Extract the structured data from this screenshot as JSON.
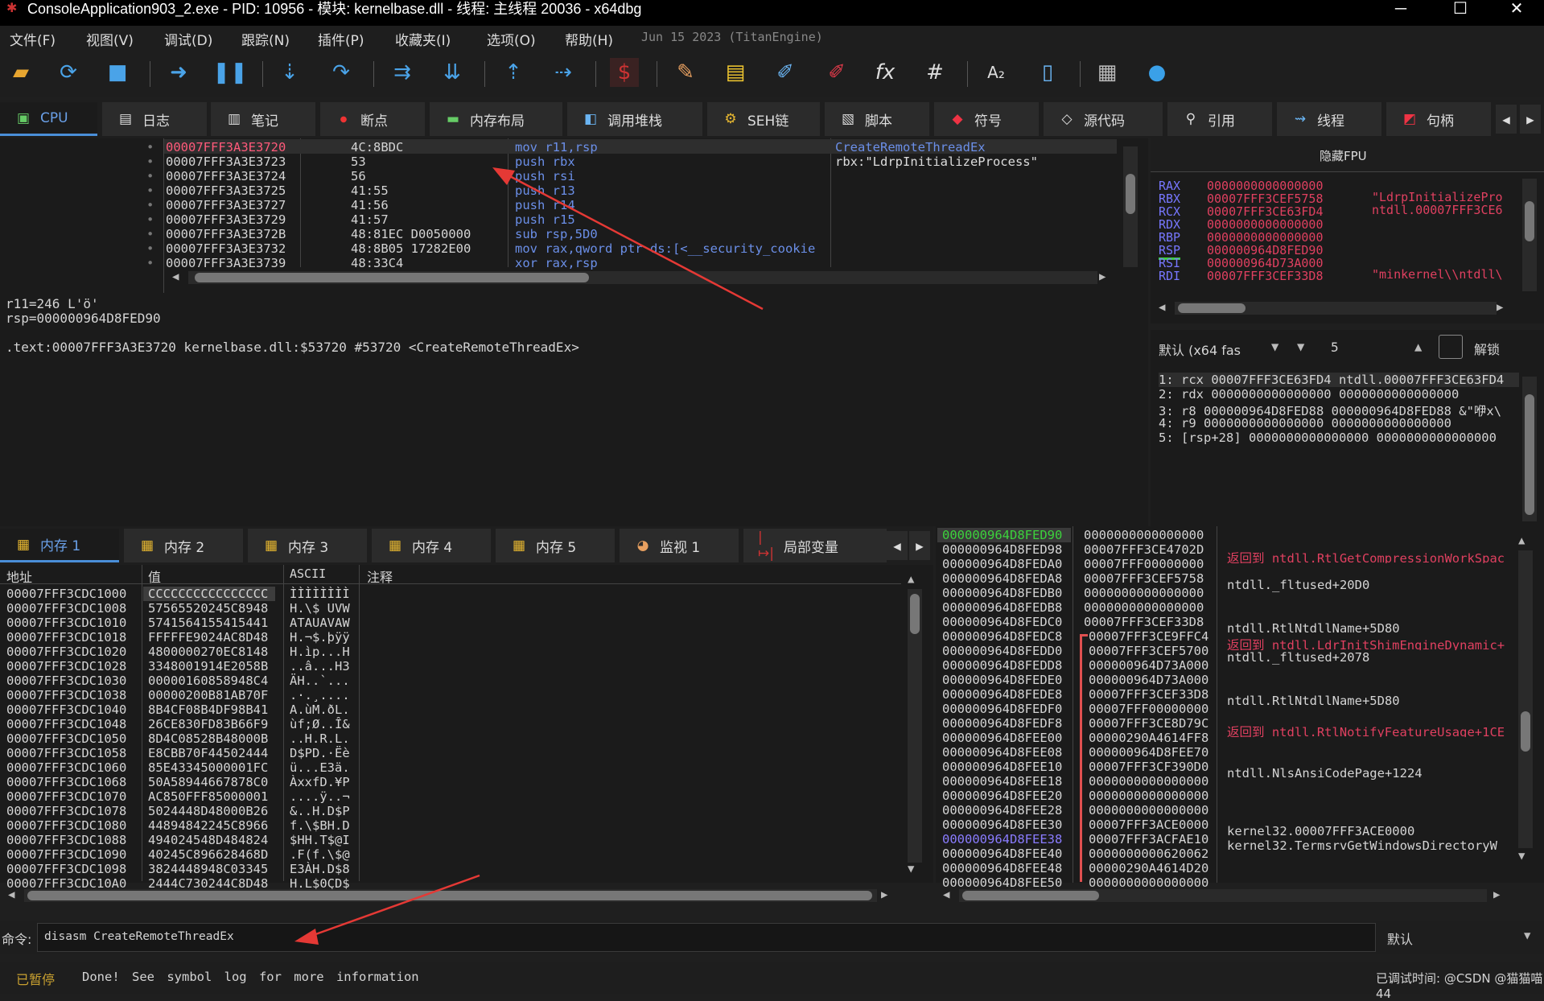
{
  "window": {
    "title": "ConsoleApplication903_2.exe - PID: 10956 - 模块: kernelbase.dll - 线程: 主线程 20036 - x64dbg"
  },
  "menu": {
    "items": [
      "文件(F)",
      "视图(V)",
      "调试(D)",
      "跟踪(N)",
      "插件(P)",
      "收藏夹(I)",
      "选项(O)",
      "帮助(H)"
    ],
    "info": "Jun 15 2023 (TitanEngine)"
  },
  "toolbar": {
    "icons": [
      "open-icon",
      "restart-icon",
      "stop-icon",
      "run-icon",
      "pause-icon",
      "step-into-icon",
      "step-over-icon",
      "trace-into-icon",
      "trace-over-icon",
      "execute-till-return-icon",
      "run-to-user-code-icon",
      "scylla-icon",
      "patch-icon",
      "comment-icon",
      "label-icon",
      "bookmark-icon",
      "function-icon",
      "hash-icon",
      "font-icon",
      "module-icon",
      "calculator-icon",
      "globe-icon"
    ]
  },
  "tabs": [
    {
      "label": "CPU",
      "icon": "cpu-icon"
    },
    {
      "label": "日志",
      "icon": "log-icon"
    },
    {
      "label": "笔记",
      "icon": "notes-icon"
    },
    {
      "label": "断点",
      "icon": "breakpoint-icon"
    },
    {
      "label": "内存布局",
      "icon": "memory-map-icon"
    },
    {
      "label": "调用堆栈",
      "icon": "call-stack-icon"
    },
    {
      "label": "SEH链",
      "icon": "seh-icon"
    },
    {
      "label": "脚本",
      "icon": "script-icon"
    },
    {
      "label": "符号",
      "icon": "symbols-icon"
    },
    {
      "label": "源代码",
      "icon": "source-icon"
    },
    {
      "label": "引用",
      "icon": "references-icon"
    },
    {
      "label": "线程",
      "icon": "threads-icon"
    },
    {
      "label": "句柄",
      "icon": "handles-icon"
    }
  ],
  "disasm": {
    "rows": [
      {
        "addr": "00007FFF3A3E3720",
        "bytes": "4C:8BDC",
        "ins": "mov r11,rsp",
        "cmt": "CreateRemoteThreadEx"
      },
      {
        "addr": "00007FFF3A3E3723",
        "bytes": "53",
        "ins": "push rbx",
        "cmt": "rbx:\"LdrpInitializeProcess\""
      },
      {
        "addr": "00007FFF3A3E3724",
        "bytes": "56",
        "ins": "push rsi",
        "cmt": ""
      },
      {
        "addr": "00007FFF3A3E3725",
        "bytes": "41:55",
        "ins": "push r13",
        "cmt": ""
      },
      {
        "addr": "00007FFF3A3E3727",
        "bytes": "41:56",
        "ins": "push r14",
        "cmt": ""
      },
      {
        "addr": "00007FFF3A3E3729",
        "bytes": "41:57",
        "ins": "push r15",
        "cmt": ""
      },
      {
        "addr": "00007FFF3A3E372B",
        "bytes": "48:81EC D0050000",
        "ins": "sub rsp,5D0",
        "cmt": ""
      },
      {
        "addr": "00007FFF3A3E3732",
        "bytes": "48:8B05 17282E00",
        "ins": "mov rax,qword ptr ds:[<__security_cookie",
        "cmt": ""
      },
      {
        "addr": "00007FFF3A3E3739",
        "bytes": "48:33C4",
        "ins": "xor rax,rsp",
        "cmt": ""
      }
    ]
  },
  "info": {
    "line1": "r11=246 L'ö'",
    "line2": "rsp=000000964D8FED90",
    "line3": ".text:00007FFF3A3E3720 kernelbase.dll:$53720 #53720 <CreateRemoteThreadEx>"
  },
  "regs": {
    "title": "隐藏FPU",
    "rows": [
      {
        "name": "RAX",
        "val": "0000000000000000",
        "cmt": ""
      },
      {
        "name": "RBX",
        "val": "00007FFF3CEF5758",
        "cmt": "\"LdrpInitializePro"
      },
      {
        "name": "RCX",
        "val": "00007FFF3CE63FD4",
        "cmt": "ntdll.00007FFF3CE6"
      },
      {
        "name": "RDX",
        "val": "0000000000000000",
        "cmt": ""
      },
      {
        "name": "RBP",
        "val": "0000000000000000",
        "cmt": ""
      },
      {
        "name": "RSP",
        "val": "000000964D8FED90",
        "cmt": ""
      },
      {
        "name": "RSI",
        "val": "000000964D73A000",
        "cmt": ""
      },
      {
        "name": "RDI",
        "val": "00007FFF3CEF33D8",
        "cmt": "\"minkernel\\\\ntdll\\"
      }
    ]
  },
  "callconv": {
    "select": "默认 (x64 fas",
    "count": "5",
    "lock_label": "解锁"
  },
  "args": {
    "rows": [
      "1: rcx 00007FFF3CE63FD4 ntdll.00007FFF3CE63FD4",
      "2: rdx 0000000000000000 0000000000000000",
      "3: r8 000000964D8FED88 000000964D8FED88 &\"咿x\\",
      "4: r9 0000000000000000 0000000000000000",
      "5: [rsp+28] 0000000000000000 0000000000000000"
    ]
  },
  "memtabs": [
    {
      "label": "内存 1",
      "icon": "memory-icon"
    },
    {
      "label": "内存 2",
      "icon": "memory-icon"
    },
    {
      "label": "内存 3",
      "icon": "memory-icon"
    },
    {
      "label": "内存 4",
      "icon": "memory-icon"
    },
    {
      "label": "内存 5",
      "icon": "memory-icon"
    },
    {
      "label": "监视 1",
      "icon": "watch-icon"
    },
    {
      "label": "局部变量",
      "icon": "locals-icon"
    }
  ],
  "dump": {
    "headers": [
      "地址",
      "值",
      "ASCII",
      "注释"
    ],
    "rows": [
      [
        "00007FFF3CDC1000",
        "CCCCCCCCCCCCCCCC",
        "ÌÌÌÌÌÌÌÌ"
      ],
      [
        "00007FFF3CDC1008",
        "57565520245C8948",
        "H.\\$ UVW"
      ],
      [
        "00007FFF3CDC1010",
        "5741564155415441",
        "ATAUAVAW"
      ],
      [
        "00007FFF3CDC1018",
        "FFFFFE9024AC8D48",
        "H.¬$.þÿÿ"
      ],
      [
        "00007FFF3CDC1020",
        "4800000270EC8148",
        "H.ìp...H"
      ],
      [
        "00007FFF3CDC1028",
        "3348001914E2058B",
        "..â...H3"
      ],
      [
        "00007FFF3CDC1030",
        "00000160858948C4",
        "ÄH..`..."
      ],
      [
        "00007FFF3CDC1038",
        "00000200B81AB70F",
        ".·.¸...."
      ],
      [
        "00007FFF3CDC1040",
        "8B4CF08B4DF98B41",
        "A.ùM.ðL."
      ],
      [
        "00007FFF3CDC1048",
        "26CE830FD83B66F9",
        "ùf;Ø..Î&"
      ],
      [
        "00007FFF3CDC1050",
        "8D4C08528B48000B",
        "..H.R.L."
      ],
      [
        "00007FFF3CDC1058",
        "E8CBB70F44502444",
        "D$PD.·Ëè"
      ],
      [
        "00007FFF3CDC1060",
        "85E43345000001FC",
        "ü...E3ä."
      ],
      [
        "00007FFF3CDC1068",
        "50A58944667878C0",
        "ÀxxfD.¥P"
      ],
      [
        "00007FFF3CDC1070",
        "AC850FFF85000001",
        "....ÿ..¬"
      ],
      [
        "00007FFF3CDC1078",
        "5024448D48000B26",
        "&..H.D$P"
      ],
      [
        "00007FFF3CDC1080",
        "44894842245C8966",
        "f.\\$BH.D"
      ],
      [
        "00007FFF3CDC1088",
        "494024548D484824",
        "$HH.T$@I"
      ],
      [
        "00007FFF3CDC1090",
        "40245C896628468D",
        ".F(f.\\$@"
      ],
      [
        "00007FFF3CDC1098",
        "3824448948C03345",
        "E3ÀH.D$8"
      ],
      [
        "00007FFF3CDC10A0",
        "2444C730244C8D48",
        "H.L$0ÇD$"
      ]
    ]
  },
  "stack": {
    "rows": [
      {
        "addr": "000000964D8FED90",
        "val": "0000000000000000",
        "cmt": ""
      },
      {
        "addr": "000000964D8FED98",
        "val": "00007FFF3CE4702D",
        "cmt": "返回到 ntdll.RtlGetCompressionWorkSpac"
      },
      {
        "addr": "000000964D8FEDA0",
        "val": "00007FFF00000000",
        "cmt": ""
      },
      {
        "addr": "000000964D8FEDA8",
        "val": "00007FFF3CEF5758",
        "cmt": "ntdll._fltused+20D0"
      },
      {
        "addr": "000000964D8FEDB0",
        "val": "0000000000000000",
        "cmt": ""
      },
      {
        "addr": "000000964D8FEDB8",
        "val": "0000000000000000",
        "cmt": ""
      },
      {
        "addr": "000000964D8FEDC0",
        "val": "00007FFF3CEF33D8",
        "cmt": "ntdll.RtlNtdllName+5D80"
      },
      {
        "addr": "000000964D8FEDC8",
        "val": "00007FFF3CE9FFC4",
        "cmt": "返回到 ntdll.LdrInitShimEngineDynamic+"
      },
      {
        "addr": "000000964D8FEDD0",
        "val": "00007FFF3CEF5700",
        "cmt": "ntdll._fltused+2078"
      },
      {
        "addr": "000000964D8FEDD8",
        "val": "000000964D73A000",
        "cmt": ""
      },
      {
        "addr": "000000964D8FEDE0",
        "val": "000000964D73A000",
        "cmt": ""
      },
      {
        "addr": "000000964D8FEDE8",
        "val": "00007FFF3CEF33D8",
        "cmt": "ntdll.RtlNtdllName+5D80"
      },
      {
        "addr": "000000964D8FEDF0",
        "val": "00007FFF00000000",
        "cmt": ""
      },
      {
        "addr": "000000964D8FEDF8",
        "val": "00007FFF3CE8D79C",
        "cmt": "返回到 ntdll.RtlNotifyFeatureUsage+1CE"
      },
      {
        "addr": "000000964D8FEE00",
        "val": "00000290A4614FF8",
        "cmt": ""
      },
      {
        "addr": "000000964D8FEE08",
        "val": "000000964D8FEE70",
        "cmt": ""
      },
      {
        "addr": "000000964D8FEE10",
        "val": "00007FFF3CF390D0",
        "cmt": "ntdll.NlsAnsiCodePage+1224"
      },
      {
        "addr": "000000964D8FEE18",
        "val": "0000000000000000",
        "cmt": ""
      },
      {
        "addr": "000000964D8FEE20",
        "val": "0000000000000000",
        "cmt": ""
      },
      {
        "addr": "000000964D8FEE28",
        "val": "0000000000000000",
        "cmt": ""
      },
      {
        "addr": "000000964D8FEE30",
        "val": "00007FFF3ACE0000",
        "cmt": "kernel32.00007FFF3ACE0000"
      },
      {
        "addr": "000000964D8FEE38",
        "val": "00007FFF3ACFAE10",
        "cmt": "kernel32.TermsrvGetWindowsDirectoryW"
      },
      {
        "addr": "000000964D8FEE40",
        "val": "0000000000620062",
        "cmt": ""
      },
      {
        "addr": "000000964D8FEE48",
        "val": "00000290A4614D20",
        "cmt": ""
      },
      {
        "addr": "000000964D8FEE50",
        "val": "0000000000000000",
        "cmt": ""
      }
    ]
  },
  "cmd": {
    "label": "命令:",
    "value": "disasm CreateRemoteThreadEx",
    "mode": "默认"
  },
  "status": {
    "state": "已暂停",
    "message": "Done! See symbol log for more information",
    "right": "已调试时间: @CSDN @猫猫喵44"
  },
  "colors": {
    "accent": "#4a8fd9",
    "addr_highlight": "#ff5a7a",
    "instr": "#6b8fe8",
    "reg_changed": "#e04060",
    "arrow": "#e53935"
  }
}
